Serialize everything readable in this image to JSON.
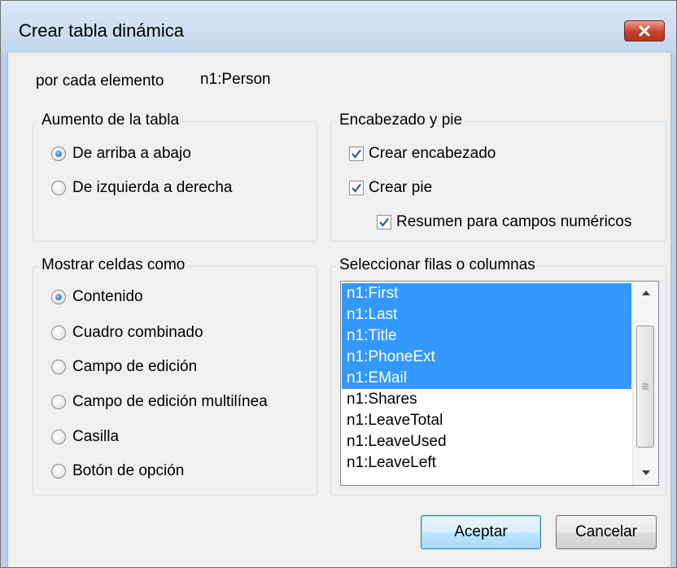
{
  "window": {
    "title": "Crear tabla dinámica"
  },
  "for_each": {
    "label": "por cada elemento",
    "value": "n1:Person"
  },
  "table_growth": {
    "legend": "Aumento de la tabla",
    "options": [
      {
        "label": "De arriba a abajo",
        "checked": true
      },
      {
        "label": "De izquierda a derecha",
        "checked": false
      }
    ]
  },
  "header_footer": {
    "legend": "Encabezado y pie",
    "create_header": {
      "label": "Crear encabezado",
      "checked": true
    },
    "create_footer": {
      "label": "Crear pie",
      "checked": true
    },
    "summary_numeric": {
      "label": "Resumen para campos numéricos",
      "checked": true
    }
  },
  "show_cells": {
    "legend": "Mostrar celdas como",
    "options": [
      {
        "label": "Contenido",
        "checked": true
      },
      {
        "label": "Cuadro combinado",
        "checked": false
      },
      {
        "label": "Campo de edición",
        "checked": false
      },
      {
        "label": "Campo de edición multilínea",
        "checked": false
      },
      {
        "label": "Casilla",
        "checked": false
      },
      {
        "label": "Botón de opción",
        "checked": false
      }
    ]
  },
  "select_rows": {
    "legend": "Seleccionar filas o columnas",
    "items": [
      {
        "label": "n1:First",
        "selected": true
      },
      {
        "label": "n1:Last",
        "selected": true
      },
      {
        "label": "n1:Title",
        "selected": true
      },
      {
        "label": "n1:PhoneExt",
        "selected": true
      },
      {
        "label": "n1:EMail",
        "selected": true
      },
      {
        "label": "n1:Shares",
        "selected": false
      },
      {
        "label": "n1:LeaveTotal",
        "selected": false
      },
      {
        "label": "n1:LeaveUsed",
        "selected": false
      },
      {
        "label": "n1:LeaveLeft",
        "selected": false
      }
    ]
  },
  "buttons": {
    "ok": "Aceptar",
    "cancel": "Cancelar"
  },
  "colors": {
    "selection": "#3399ff",
    "close_button": "#c8412d"
  }
}
